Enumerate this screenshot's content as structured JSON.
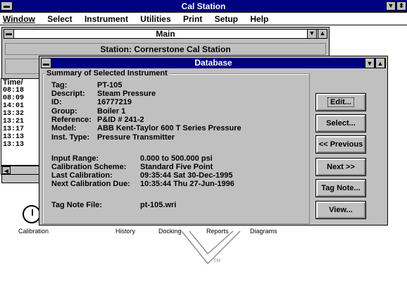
{
  "app": {
    "title": "Cal Station"
  },
  "menu": [
    "Window",
    "Select",
    "Instrument",
    "Utilities",
    "Print",
    "Setup",
    "Help"
  ],
  "main_window": {
    "title": "Main",
    "station_label": "Station: Cornerstone Cal Station",
    "time_header": "Time/",
    "time_rows": [
      "08:18",
      "08:09",
      "14:01",
      "13:32",
      "13:21",
      "13:17",
      "13:13",
      "13:13"
    ]
  },
  "dock": {
    "labels": [
      "Calibration",
      "History",
      "Docking",
      "Reports",
      "Diagrams"
    ],
    "trademark": "TM"
  },
  "database_window": {
    "title": "Database",
    "group_title": "Summary of Selected Instrument",
    "fields": [
      {
        "label": "Tag:",
        "value": "PT-105"
      },
      {
        "label": "Descript:",
        "value": "Steam Pressure"
      },
      {
        "label": "ID:",
        "value": "16777219"
      },
      {
        "label": "Group:",
        "value": "Boiler 1"
      },
      {
        "label": "Reference:",
        "value": "P&ID # 241-2"
      },
      {
        "label": "Model:",
        "value": "ABB Kent-Taylor 600 T Series Pressure"
      },
      {
        "label": "Inst. Type:",
        "value": "Pressure Transmitter"
      }
    ],
    "cal_fields": [
      {
        "label": "Input Range:",
        "value": "0.000 to 500.000 psi"
      },
      {
        "label": "Calibration Scheme:",
        "value": "Standard Five Point"
      },
      {
        "label": "Last Calibration:",
        "value": "09:35:44 Sat 30-Dec-1995"
      },
      {
        "label": "Next Calibration Due:",
        "value": "10:35:44 Thu 27-Jun-1996"
      }
    ],
    "tag_note": {
      "label": "Tag Note File:",
      "value": "pt-105.wri"
    },
    "buttons": {
      "edit": "Edit...",
      "select": "Select...",
      "previous": "<< Previous",
      "next": "Next >>",
      "tag_note": "Tag Note...",
      "view": "View..."
    }
  }
}
